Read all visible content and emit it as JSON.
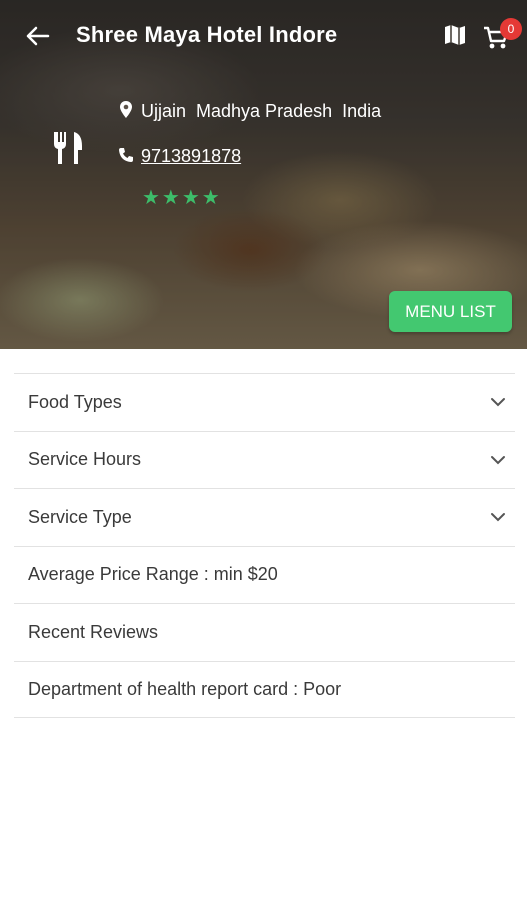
{
  "header": {
    "title": "Shree Maya Hotel Indore",
    "back_icon": "arrow-back-icon",
    "map_icon": "map-icon",
    "cart_icon": "cart-icon",
    "cart_count": "0"
  },
  "restaurant": {
    "category_icon": "restaurant-icon",
    "location": "Ujjain  Madhya Pradesh  India",
    "phone": "9713891878",
    "rating": 4,
    "stars": "★★★★"
  },
  "menu_button": {
    "label": "MENU LIST"
  },
  "details": {
    "rows": [
      {
        "label": "Food Types",
        "expandable": true
      },
      {
        "label": "Service Hours",
        "expandable": true
      },
      {
        "label": "Service Type",
        "expandable": true
      },
      {
        "label": "Average Price Range : min $20",
        "expandable": false
      },
      {
        "label": "Recent Reviews",
        "expandable": false
      },
      {
        "label": "Department of health report card : Poor",
        "expandable": false
      }
    ]
  },
  "colors": {
    "accent_green": "#43c870",
    "star_green": "#3dbd6a",
    "badge_red": "#e53935"
  }
}
